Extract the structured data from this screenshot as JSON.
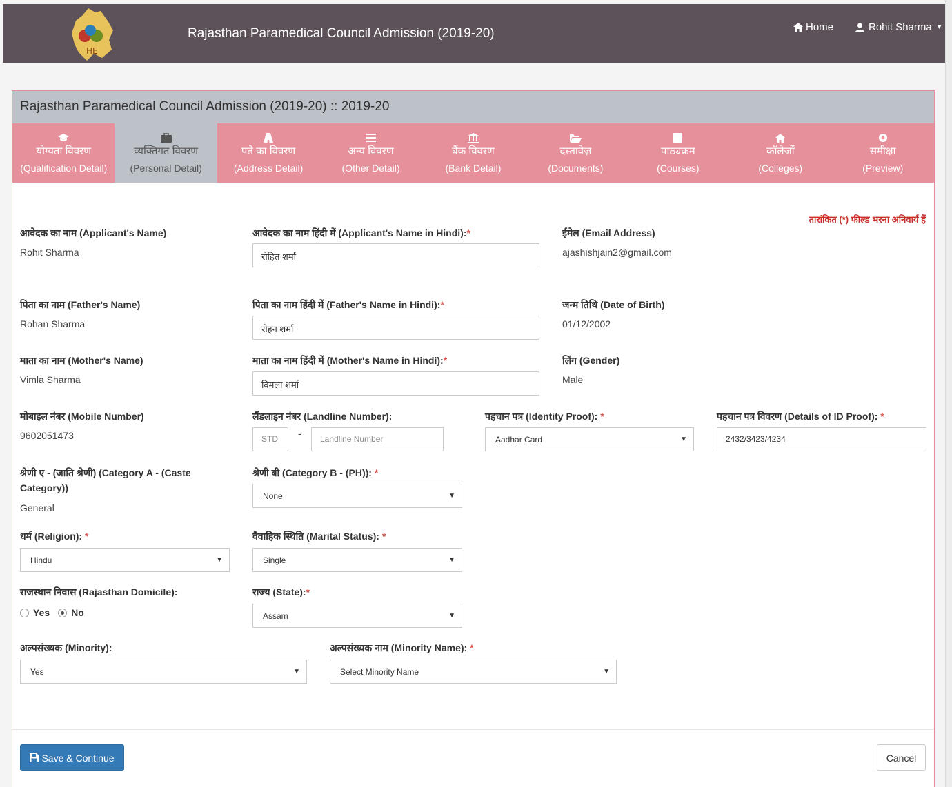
{
  "header": {
    "app_title": "Rajasthan Paramedical Council Admission (2019-20)",
    "home_label": "Home",
    "user_name": "Rohit Sharma"
  },
  "panel": {
    "title": "Rajasthan Paramedical Council Admission (2019-20) :: 2019-20"
  },
  "steps": [
    {
      "hi": "योग्यता विवरण",
      "en": "(Qualification Detail)",
      "icon": "graduation-cap-icon"
    },
    {
      "hi": "व्यक्तिगत विवरण",
      "en": "(Personal Detail)",
      "icon": "briefcase-icon"
    },
    {
      "hi": "पते का विवरण",
      "en": "(Address Detail)",
      "icon": "road-icon"
    },
    {
      "hi": "अन्य विवरण",
      "en": "(Other Detail)",
      "icon": "list-icon"
    },
    {
      "hi": "बैंक विवरण",
      "en": "(Bank Detail)",
      "icon": "bank-icon"
    },
    {
      "hi": "दस्तावेज़",
      "en": "(Documents)",
      "icon": "folder-open-icon"
    },
    {
      "hi": "पाठ्यक्रम",
      "en": "(Courses)",
      "icon": "book-icon"
    },
    {
      "hi": "कॉलेजों",
      "en": "(Colleges)",
      "icon": "home-icon"
    },
    {
      "hi": "समीक्षा",
      "en": "(Preview)",
      "icon": "eye-icon"
    }
  ],
  "form": {
    "mandatory_note": "तारांकित (*) फील्ड भरना अनिवार्य हैं",
    "applicant_name_label": "आवेदक का नाम (Applicant's Name)",
    "applicant_name": "Rohit Sharma",
    "applicant_name_hindi_label": "आवेदक का नाम हिंदी में (Applicant's Name in Hindi):",
    "applicant_name_hindi": "रोहित शर्मा",
    "email_label": "ईमेल (Email Address)",
    "email": "ajashishjain2@gmail.com",
    "father_name_label": "पिता का नाम (Father's Name)",
    "father_name": "Rohan Sharma",
    "father_name_hindi_label": "पिता का नाम हिंदी में (Father's Name in Hindi):",
    "father_name_hindi": "रोहन शर्मा",
    "dob_label": "जन्म तिथि (Date of Birth)",
    "dob": "01/12/2002",
    "mother_name_label": "माता का नाम (Mother's Name)",
    "mother_name": "Vimla Sharma",
    "mother_name_hindi_label": "माता का नाम हिंदी में (Mother's Name in Hindi):",
    "mother_name_hindi": "विमला शर्मा",
    "gender_label": "लिंग (Gender)",
    "gender": "Male",
    "mobile_label": "मोबाइल नंबर (Mobile Number)",
    "mobile": "9602051473",
    "landline_label": "लैंडलाइन नंबर (Landline Number):",
    "std_placeholder": "STD",
    "landline_placeholder": "Landline Number",
    "id_proof_label": "पहचान पत्र (Identity Proof):",
    "id_proof": "Aadhar Card",
    "id_details_label": "पहचान पत्र विवरण (Details of ID Proof):",
    "id_details": "2432/3423/4234",
    "category_a_label_1": "श्रेणी ए - (जाति श्रेणी) (Category A - (Caste",
    "category_a_label_2": "Category))",
    "category_a": "General",
    "category_b_label": "श्रेणी बी (Category B - (PH)):",
    "category_b": "None",
    "religion_label": "धर्म (Religion):",
    "religion": "Hindu",
    "marital_label": "वैवाहिक स्थिति (Marital Status):",
    "marital": "Single",
    "domicile_label": "राजस्थान निवास (Rajasthan Domicile):",
    "domicile_yes": "Yes",
    "domicile_no": "No",
    "domicile_selected": "No",
    "state_label": "राज्य (State):",
    "state": "Assam",
    "minority_label": "अल्पसंख्यक (Minority):",
    "minority": "Yes",
    "minority_name_label": "अल्पसंख्यक नाम (Minority Name):",
    "minority_name": "Select Minority Name",
    "required_mark": "*"
  },
  "buttons": {
    "save": "Save & Continue",
    "cancel": "Cancel"
  },
  "colors": {
    "navbar": "#5d5259",
    "tabs": "#e6909c",
    "active_tab": "#bdc1c8",
    "primary": "#337ab7",
    "required": "#d9534f"
  }
}
